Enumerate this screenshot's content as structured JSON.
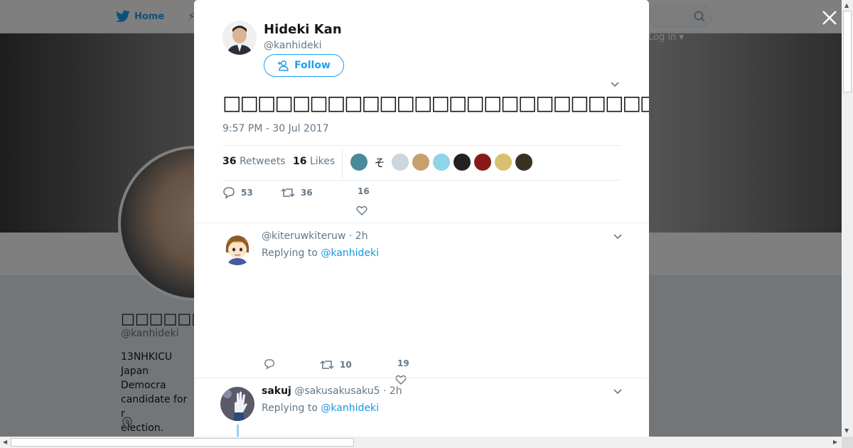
{
  "nav": {
    "home_label": "Home",
    "login_label": "Log in"
  },
  "background_profile": {
    "name": "□□□□□□□□□",
    "handle": "@kanhideki",
    "bio_lines": [
      "13NHKICU",
      "Japan Democra",
      "candidate for r",
      "election."
    ]
  },
  "tweet": {
    "author_name": "Hideki Kan",
    "author_handle": "@kanhideki",
    "follow_label": "Follow",
    "text": "□□□□□□□□□□□□□□□□□□□□□□□□□□□□□□□□□□□□□□□□□□□□□□□□□□□□□□□",
    "timestamp": "9:57 PM - 30 Jul 2017",
    "retweets_count": "36",
    "retweets_label": "Retweets",
    "likes_count": "16",
    "likes_label": "Likes",
    "likers": [
      {
        "icon": "liker-avatar-1",
        "color": "#4a8a9a"
      },
      {
        "icon": "liker-avatar-2",
        "text": "そ",
        "color": "#ffffff"
      },
      {
        "icon": "liker-avatar-3",
        "color": "#ccd6dd"
      },
      {
        "icon": "liker-avatar-4",
        "color": "#c8a070"
      },
      {
        "icon": "liker-avatar-5",
        "color": "#8fd4e8"
      },
      {
        "icon": "liker-avatar-6",
        "color": "#222222"
      },
      {
        "icon": "liker-avatar-7",
        "color": "#8a1a1a"
      },
      {
        "icon": "liker-avatar-8",
        "color": "#d8c070"
      },
      {
        "icon": "liker-avatar-9",
        "color": "#3a3220"
      }
    ],
    "actions": {
      "replies": "53",
      "retweets": "36",
      "likes": "16"
    }
  },
  "replies": [
    {
      "name": "",
      "handle": "@kiteruwkiteruw",
      "time": "· 2h",
      "replying_prefix": "Replying to",
      "replying_to": "@kanhideki",
      "actions": {
        "replies": "",
        "retweets": "10",
        "likes": "19"
      }
    },
    {
      "name": "sakuj",
      "handle": "@sakusakusaku5",
      "time": "· 2h",
      "replying_prefix": "Replying to",
      "replying_to": "@kanhideki"
    }
  ],
  "colors": {
    "accent": "#1da1f2",
    "link": "#1b95e0",
    "text": "#14171a",
    "muted": "#657786"
  }
}
